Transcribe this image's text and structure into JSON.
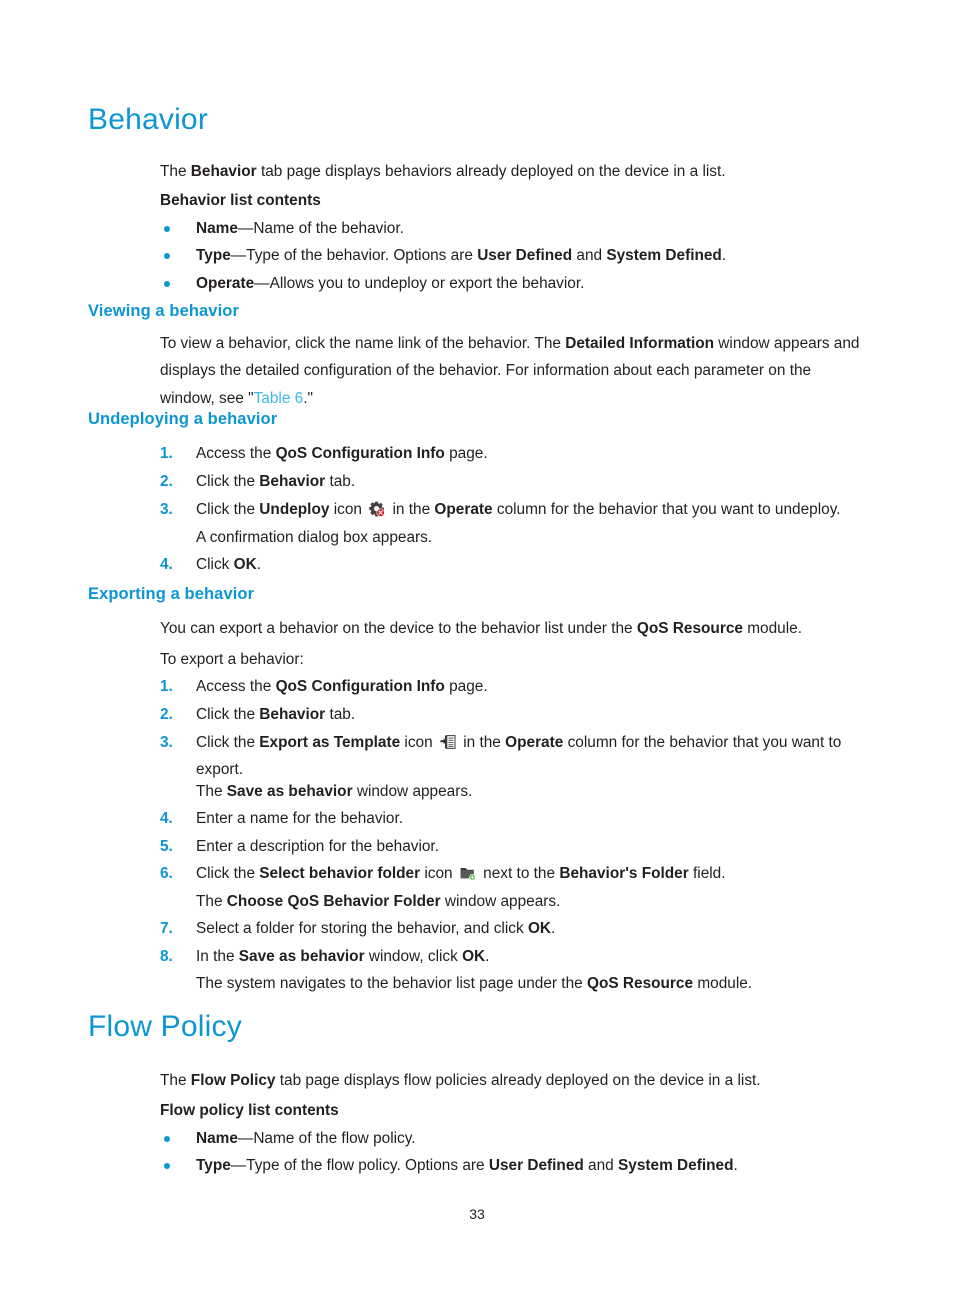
{
  "document": {
    "page_number": "33",
    "accent_heading_color": "#0c96d2",
    "link_color": "#3fb6e8",
    "body_text_color": "#231f20"
  },
  "sections": [
    {
      "id": "behavior",
      "heading": "Behavior",
      "intro": {
        "t1": "The ",
        "b1": "Behavior",
        "t2": " tab page displays behaviors already deployed on the device in a list."
      },
      "list_contents_heading": "Behavior list contents",
      "bullets": [
        {
          "term": "Name",
          "dash": "—",
          "rest": "Name of the behavior."
        },
        {
          "term": "Type",
          "dash": "—",
          "rest_a": "Type of the behavior. Options are ",
          "bold_a": "User Defined",
          "mid": " and ",
          "bold_b": "System Defined",
          "rest_b": "."
        },
        {
          "term": "Operate",
          "dash": "—",
          "rest": "Allows you to undeploy or export the behavior."
        }
      ]
    }
  ],
  "viewing": {
    "heading": "Viewing a behavior",
    "p_a": "To view a behavior, click the name link of the behavior. The ",
    "p_bold": "Detailed Information",
    "p_b": " window appears and displays the detailed configuration of the behavior. For information about each parameter on the window, see \"",
    "p_link": "Table 6",
    "p_c": ".\""
  },
  "undeploying": {
    "heading": "Undeploying a behavior",
    "steps": [
      {
        "num": "1.",
        "a": "Access the ",
        "bold": "QoS Configuration Info",
        "b": " page."
      },
      {
        "num": "2.",
        "a": "Click the ",
        "bold": "Behavior",
        "b": " tab."
      },
      {
        "num": "3.",
        "a": "Click the ",
        "bold": "Undeploy",
        "b": " icon ",
        "icon": "undeploy-gear-icon",
        "c": " in the ",
        "bold2": "Operate",
        "d": " column for the behavior that you want to undeploy."
      },
      {
        "num": "4.",
        "a": "Click ",
        "bold": "OK",
        "b": "."
      }
    ],
    "step3_followup": "A confirmation dialog box appears."
  },
  "exporting": {
    "heading": "Exporting a behavior",
    "intro_a": "You can export a behavior on the device to the behavior list under the ",
    "intro_bold": "QoS Resource",
    "intro_b": " module.",
    "lead_in": "To export a behavior:",
    "steps": [
      {
        "num": "1.",
        "a": "Access the ",
        "bold": "QoS Configuration Info",
        "b": " page."
      },
      {
        "num": "2.",
        "a": "Click the ",
        "bold": "Behavior",
        "b": " tab."
      },
      {
        "num": "3.",
        "a": "Click the ",
        "bold": "Export as Template",
        "b": " icon ",
        "icon": "export-template-icon",
        "c": " in the ",
        "bold2": "Operate",
        "d": " column for the behavior that you want to export."
      },
      {
        "num": "4.",
        "a": "Enter a name for the behavior."
      },
      {
        "num": "5.",
        "a": "Enter a description for the behavior."
      },
      {
        "num": "6.",
        "a": "Click the ",
        "bold": "Select behavior folder",
        "b": " icon ",
        "icon": "select-folder-icon",
        "c": " next to the ",
        "bold2": "Behavior's Folder",
        "d": " field."
      },
      {
        "num": "7.",
        "a": "Select a folder for storing the behavior, and click ",
        "bold": "OK",
        "b": "."
      },
      {
        "num": "8.",
        "a": "In the ",
        "bold": "Save as behavior",
        "b": " window, click ",
        "bold2": "OK",
        "c": "."
      }
    ],
    "step3_followup_a": "The ",
    "step3_followup_bold": "Save as behavior",
    "step3_followup_b": " window appears.",
    "step6_followup_a": "The ",
    "step6_followup_bold": "Choose QoS Behavior Folder",
    "step6_followup_b": " window appears.",
    "step8_followup_a": "The system navigates to the behavior list page under the ",
    "step8_followup_bold": "QoS Resource",
    "step8_followup_b": " module."
  },
  "flow_policy": {
    "heading": "Flow Policy",
    "intro_a": "The ",
    "intro_bold": "Flow Policy",
    "intro_b": " tab page displays flow policies already deployed on the device in a list.",
    "list_contents_heading": "Flow policy list contents",
    "bullets": [
      {
        "term": "Name",
        "dash": "—",
        "rest": "Name of the flow policy."
      },
      {
        "term": "Type",
        "dash": "—",
        "rest_a": "Type of the flow policy. Options are ",
        "bold_a": "User Defined",
        "mid": " and ",
        "bold_b": "System Defined",
        "rest_b": "."
      }
    ]
  }
}
